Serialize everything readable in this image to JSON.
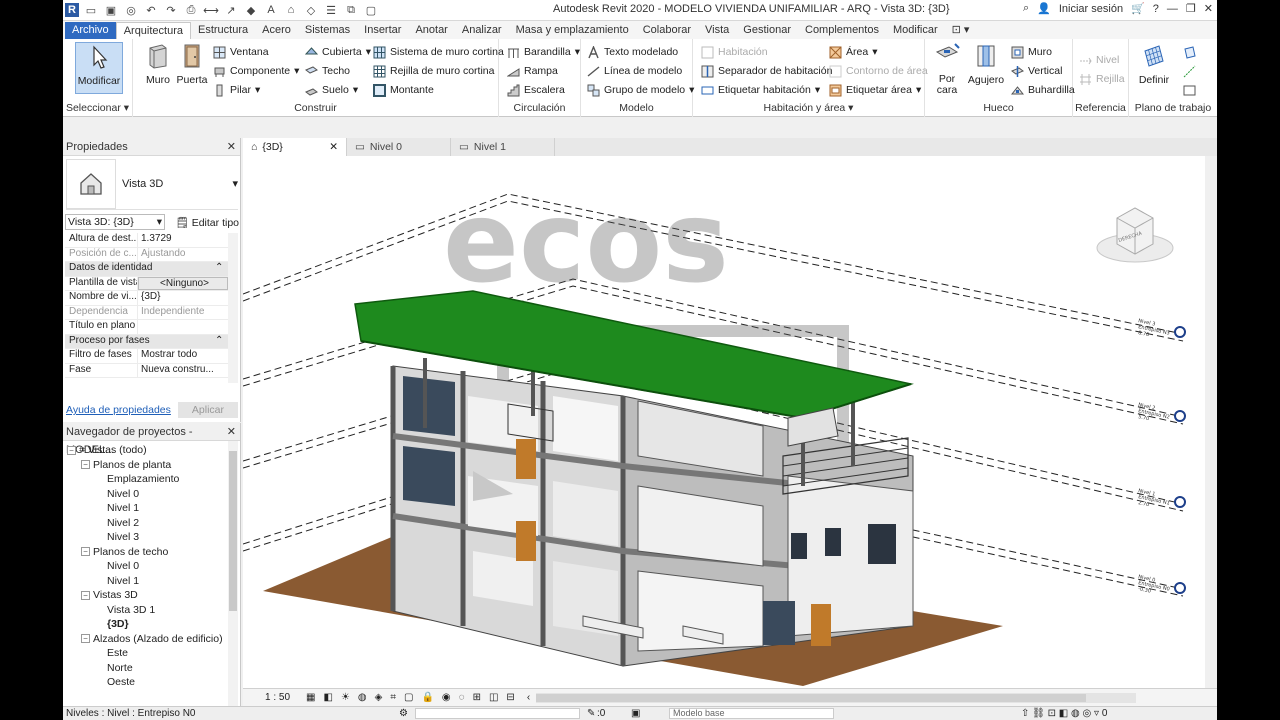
{
  "window": {
    "title": "Autodesk Revit 2020 - MODELO VIVIENDA UNIFAMILIAR - ARQ - Vista 3D: {3D}",
    "sign_in": "Iniciar sesión",
    "help": "?"
  },
  "tabs": [
    "Archivo",
    "Arquitectura",
    "Estructura",
    "Acero",
    "Sistemas",
    "Insertar",
    "Anotar",
    "Analizar",
    "Masa y emplazamiento",
    "Colaborar",
    "Vista",
    "Gestionar",
    "Complementos",
    "Modificar"
  ],
  "ribbon": {
    "select": {
      "modify": "Modificar",
      "label": "Seleccionar"
    },
    "build": {
      "label": "Construir",
      "wall": "Muro",
      "door": "Puerta",
      "window": "Ventana",
      "component": "Componente",
      "column": "Pilar",
      "roof": "Cubierta",
      "ceiling": "Techo",
      "floor": "Suelo",
      "curtain_system": "Sistema de muro cortina",
      "curtain_grid": "Rejilla de muro cortina",
      "mullion": "Montante"
    },
    "circulation": {
      "label": "Circulación",
      "railing": "Barandilla",
      "ramp": "Rampa",
      "stair": "Escalera"
    },
    "model": {
      "label": "Modelo",
      "model_text": "Texto modelado",
      "model_line": "Línea de modelo",
      "model_group": "Grupo de modelo"
    },
    "room": {
      "label": "Habitación y área",
      "room": "Habitación",
      "room_separator": "Separador de habitación",
      "tag_room": "Etiquetar habitación",
      "area": "Área",
      "area_boundary": "Contorno de área",
      "tag_area": "Etiquetar área"
    },
    "opening": {
      "label": "Hueco",
      "by_face": "Por cara",
      "shaft": "Agujero",
      "wall": "Muro",
      "vertical": "Vertical",
      "dormer": "Buhardilla"
    },
    "datum": {
      "label": "Referencia",
      "level": "Nivel",
      "grid": "Rejilla"
    },
    "workplane": {
      "label": "Plano de trabajo",
      "set": "Definir"
    }
  },
  "properties": {
    "title": "Propiedades",
    "type_name": "Vista 3D",
    "view_selector": "Vista 3D: {3D}",
    "edit_type": "Editar tipo",
    "rows": [
      {
        "k": "Altura de dest...",
        "v": "1.3729",
        "kind": "row"
      },
      {
        "k": "Posición de c...",
        "v": "Ajustando",
        "kind": "gray"
      },
      {
        "k": "Datos de identidad",
        "v": "",
        "kind": "grp"
      },
      {
        "k": "Plantilla de vista",
        "v": "<Ninguno>",
        "kind": "row"
      },
      {
        "k": "Nombre de vi...",
        "v": "{3D}",
        "kind": "row"
      },
      {
        "k": "Dependencia",
        "v": "Independiente",
        "kind": "gray"
      },
      {
        "k": "Título en plano",
        "v": "",
        "kind": "row"
      },
      {
        "k": "Proceso por fases",
        "v": "",
        "kind": "grp"
      },
      {
        "k": "Filtro de fases",
        "v": "Mostrar todo",
        "kind": "row"
      },
      {
        "k": "Fase",
        "v": "Nueva constru...",
        "kind": "row"
      }
    ],
    "help_link": "Ayuda de propiedades",
    "apply": "Aplicar"
  },
  "browser": {
    "title": "Navegador de proyectos - MODEL...",
    "nodes": [
      {
        "t": "Vistas (todo)",
        "d": 0,
        "tog": "−"
      },
      {
        "t": "Planos de planta",
        "d": 1,
        "tog": "−"
      },
      {
        "t": "Emplazamiento",
        "d": 2,
        "tog": ""
      },
      {
        "t": "Nivel 0",
        "d": 2,
        "tog": ""
      },
      {
        "t": "Nivel 1",
        "d": 2,
        "tog": ""
      },
      {
        "t": "Nivel 2",
        "d": 2,
        "tog": ""
      },
      {
        "t": "Nivel 3",
        "d": 2,
        "tog": ""
      },
      {
        "t": "Planos de techo",
        "d": 1,
        "tog": "−"
      },
      {
        "t": "Nivel 0",
        "d": 2,
        "tog": ""
      },
      {
        "t": "Nivel 1",
        "d": 2,
        "tog": ""
      },
      {
        "t": "Vistas 3D",
        "d": 1,
        "tog": "−"
      },
      {
        "t": "Vista 3D 1",
        "d": 2,
        "tog": ""
      },
      {
        "t": "{3D}",
        "d": 2,
        "tog": ""
      },
      {
        "t": "Alzados (Alzado de edificio)",
        "d": 1,
        "tog": "−"
      },
      {
        "t": "Este",
        "d": 2,
        "tog": ""
      },
      {
        "t": "Norte",
        "d": 2,
        "tog": ""
      },
      {
        "t": "Oeste",
        "d": 2,
        "tog": ""
      }
    ]
  },
  "view_tabs": [
    "{3D}",
    "Nivel 0",
    "Nivel 1"
  ],
  "levels": [
    {
      "name": "Nivel 3",
      "sub": "Entrepiso N3",
      "elev": "8.70"
    },
    {
      "name": "Nivel 2",
      "sub": "Entrepiso N2",
      "elev": "5.70"
    },
    {
      "name": "Nivel 1",
      "sub": "Entrepiso N1",
      "elev": "2.70"
    },
    {
      "name": "Nivel 0",
      "sub": "Entrepiso N0",
      "elev": "-0.30"
    }
  ],
  "viewcube_label": "DERECHA",
  "watermark": "ecos",
  "view_control": {
    "scale": "1 : 50"
  },
  "status": {
    "text": "Niveles : Nivel : Entrepiso N0",
    "count": ":0",
    "model": "Modelo base"
  },
  "colors": {
    "roof": "#1e8a1e",
    "file_tab": "#2f6ac1",
    "ground": "#8a5a32"
  }
}
